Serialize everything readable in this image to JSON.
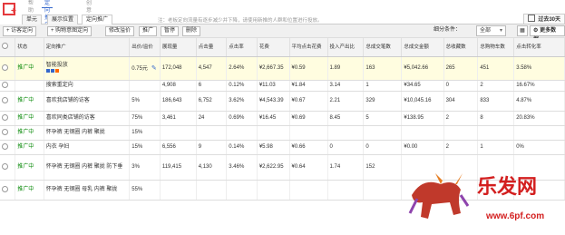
{
  "top": {
    "tabs": [
      "帮助",
      "定向推广",
      "创意"
    ],
    "logo_icon": "plus-square-icon"
  },
  "tabs": [
    "单元",
    "展示位置",
    "定向推广"
  ],
  "notice": "注：老板定向流量有逐步减少并下降，请使用新推的人群和位置进行投放。",
  "date_range": "过去30天",
  "toolbar": {
    "buttons": [
      "+ 访客定向",
      "+ 购物意图定向",
      "修改溢价",
      "推广",
      "暂停",
      "删除"
    ],
    "filter_label": "细分条件：",
    "filter_value": "全部",
    "more_label": "更多数据"
  },
  "columns": [
    "",
    "状态",
    "定向推广",
    "出价/溢价",
    "展现量",
    "点击量",
    "点击率",
    "花费",
    "平均点击花费",
    "投入产出比",
    "总成交笔数",
    "总成交金额",
    "总收藏数",
    "总购物车数",
    "点击转化率"
  ],
  "rows": [
    {
      "status": "推广中",
      "name": "智能投放",
      "bid": "0.75元",
      "impr": "172,048",
      "clicks": "4,547",
      "ctr": "2.64%",
      "cost": "¥2,667.35",
      "cpc": "¥0.59",
      "roi": "1.89",
      "orders": "163",
      "gmv": "¥5,042.66",
      "fav": "265",
      "cart": "451",
      "cvr": "3.58%",
      "hl": true
    },
    {
      "status": "",
      "name": "搜索重定向",
      "bid": "",
      "impr": "4,908",
      "clicks": "6",
      "ctr": "0.12%",
      "cost": "¥11.03",
      "cpc": "¥1.84",
      "roi": "3.14",
      "orders": "1",
      "gmv": "¥34.65",
      "fav": "0",
      "cart": "2",
      "cvr": "16.67%"
    },
    {
      "status": "推广中",
      "name": "喜欢我店铺的访客",
      "bid": "5%",
      "impr": "186,643",
      "clicks": "6,752",
      "ctr": "3.62%",
      "cost": "¥4,543.39",
      "cpc": "¥0.67",
      "roi": "2.21",
      "orders": "329",
      "gmv": "¥10,045.16",
      "fav": "304",
      "cart": "833",
      "cvr": "4.87%"
    },
    {
      "status": "推广中",
      "name": "喜欢同类店铺的访客",
      "bid": "75%",
      "impr": "3,461",
      "clicks": "24",
      "ctr": "0.69%",
      "cost": "¥16.45",
      "cpc": "¥0.69",
      "roi": "8.45",
      "orders": "5",
      "gmv": "¥138.95",
      "fav": "2",
      "cart": "8",
      "cvr": "20.83%"
    },
    {
      "status": "推广中",
      "name": "怀孕裤 无钢圈 内裤 聚拢",
      "bid": "15%",
      "impr": "",
      "clicks": "",
      "ctr": "",
      "cost": "",
      "cpc": "",
      "roi": "",
      "orders": "",
      "gmv": "",
      "fav": "",
      "cart": "",
      "cvr": ""
    },
    {
      "status": "推广中",
      "name": "内衣 孕妇",
      "bid": "15%",
      "impr": "6,556",
      "clicks": "9",
      "ctr": "0.14%",
      "cost": "¥5.98",
      "cpc": "¥0.66",
      "roi": "0",
      "orders": "0",
      "gmv": "¥0.00",
      "fav": "2",
      "cart": "1",
      "cvr": "0%"
    },
    {
      "status": "推广中",
      "name": "怀孕裤 无钢圈 内裤 聚拢 防下垂",
      "bid": "3%",
      "impr": "119,415",
      "clicks": "4,130",
      "ctr": "3.46%",
      "cost": "¥2,622.95",
      "cpc": "¥0.64",
      "roi": "1.74",
      "orders": "152",
      "gmv": "",
      "fav": "",
      "cart": "",
      "cvr": ""
    },
    {
      "status": "推广中",
      "name": "怀孕裤 无钢圈 母乳 内裤 聚拢",
      "bid": "55%",
      "impr": "",
      "clicks": "",
      "ctr": "",
      "cost": "",
      "cpc": "",
      "roi": "",
      "orders": "",
      "gmv": "",
      "fav": "",
      "cart": "",
      "cvr": ""
    }
  ],
  "watermark": {
    "title": "乐发网",
    "url": "www.6pf.com"
  }
}
